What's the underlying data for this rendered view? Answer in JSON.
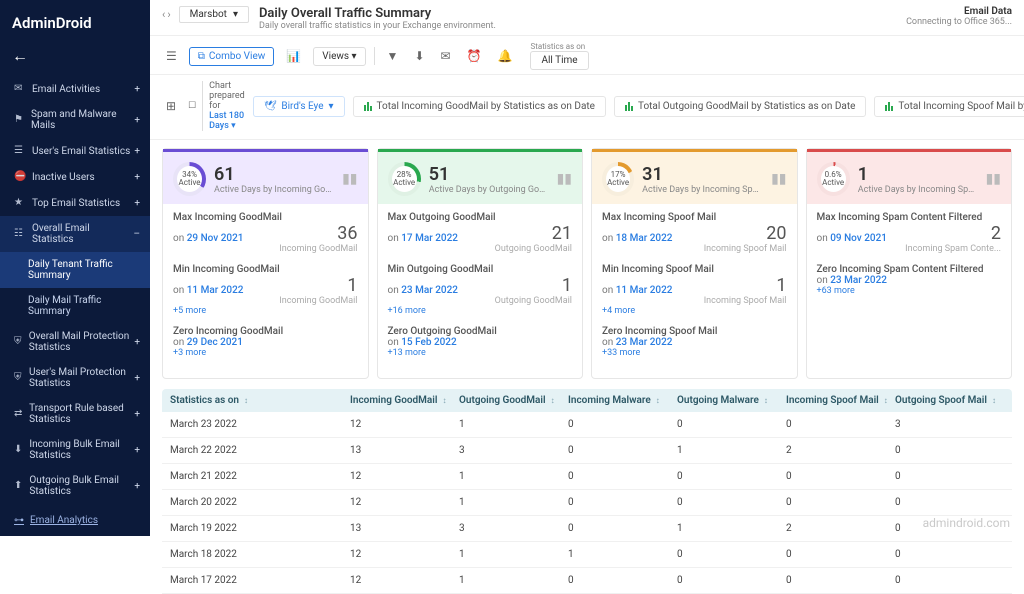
{
  "brand": "AdminDroid",
  "marsbot": "Marsbot",
  "title": "Daily Overall Traffic Summary",
  "subtitle": "Daily overall traffic statistics in your Exchange environment.",
  "top_right": {
    "title": "Email Data",
    "status": "Connecting to Office 365..."
  },
  "sidebar": {
    "items": [
      {
        "label": "Email Activities"
      },
      {
        "label": "Spam and Malware Mails"
      },
      {
        "label": "User's Email Statistics"
      },
      {
        "label": "Inactive Users"
      },
      {
        "label": "Top Email Statistics"
      },
      {
        "label": "Overall Email Statistics"
      },
      {
        "label": "Overall Mail Protection Statistics"
      },
      {
        "label": "User's Mail Protection Statistics"
      },
      {
        "label": "Transport Rule based Statistics"
      },
      {
        "label": "Incoming Bulk Email Statistics"
      },
      {
        "label": "Outgoing Bulk Email Statistics"
      }
    ],
    "subitems": [
      {
        "label": "Daily Tenant Traffic Summary",
        "active": true
      },
      {
        "label": "Daily Mail Traffic Summary"
      }
    ],
    "footer": "Email Analytics"
  },
  "toolbar": {
    "combo": "Combo View",
    "views": "Views",
    "stats_label": "Statistics as on",
    "stats_value": "All Time",
    "chart_prepared_label": "Chart prepared for",
    "chart_prepared_value": "Last 180 Days"
  },
  "tabs": [
    {
      "label": "Bird's Eye",
      "active": true
    },
    {
      "label": "Total Incoming GoodMail by Statistics as on Date"
    },
    {
      "label": "Total Outgoing GoodMail by Statistics as on Date"
    },
    {
      "label": "Total Incoming Spoof Mail by Statistics as on Date"
    }
  ],
  "cards": [
    {
      "pct": "34%",
      "active": "Active",
      "value": "61",
      "label": "Active Days by Incoming Goo...",
      "stats": [
        {
          "title": "Max Incoming GoodMail",
          "date": "29 Nov 2021",
          "value": "36",
          "unit": "Incoming GoodMail",
          "more": ""
        },
        {
          "title": "Min Incoming GoodMail",
          "date": "11 Mar 2022",
          "value": "1",
          "unit": "Incoming GoodMail",
          "more": "+5 more"
        },
        {
          "title": "Zero Incoming GoodMail",
          "date": "29 Dec 2021",
          "value": "",
          "unit": "",
          "more": "+3 more"
        }
      ]
    },
    {
      "pct": "28%",
      "active": "Active",
      "value": "51",
      "label": "Active Days by Outgoing Goo...",
      "stats": [
        {
          "title": "Max Outgoing GoodMail",
          "date": "17 Mar 2022",
          "value": "21",
          "unit": "Outgoing GoodMail",
          "more": ""
        },
        {
          "title": "Min Outgoing GoodMail",
          "date": "23 Mar 2022",
          "value": "1",
          "unit": "Outgoing GoodMail",
          "more": "+16 more"
        },
        {
          "title": "Zero Outgoing GoodMail",
          "date": "15 Feb 2022",
          "value": "",
          "unit": "",
          "more": "+13 more"
        }
      ]
    },
    {
      "pct": "17%",
      "active": "Active",
      "value": "31",
      "label": "Active Days by Incoming Spoo...",
      "stats": [
        {
          "title": "Max Incoming Spoof Mail",
          "date": "18 Mar 2022",
          "value": "20",
          "unit": "Incoming Spoof Mail",
          "more": ""
        },
        {
          "title": "Min Incoming Spoof Mail",
          "date": "11 Mar 2022",
          "value": "1",
          "unit": "Incoming Spoof Mail",
          "more": "+4 more"
        },
        {
          "title": "Zero Incoming Spoof Mail",
          "date": "23 Mar 2022",
          "value": "",
          "unit": "",
          "more": "+33 more"
        }
      ]
    },
    {
      "pct": "0.6%",
      "active": "Active",
      "value": "1",
      "label": "Active Days by Incoming Spa...",
      "stats": [
        {
          "title": "Max Incoming Spam Content Filtered",
          "date": "09 Nov 2021",
          "value": "2",
          "unit": "Incoming Spam Conte...",
          "more": ""
        },
        {
          "title": "Zero Incoming Spam Content Filtered",
          "date": "23 Mar 2022",
          "value": "",
          "unit": "",
          "more": "+63 more"
        }
      ]
    }
  ],
  "table": {
    "headers": [
      "Statistics as on",
      "Incoming GoodMail",
      "Outgoing GoodMail",
      "Incoming Malware",
      "Outgoing Malware",
      "Incoming Spoof Mail",
      "Outgoing Spoof Mail"
    ],
    "rows": [
      [
        "March 23 2022",
        "12",
        "1",
        "0",
        "0",
        "0",
        "3"
      ],
      [
        "March 22 2022",
        "13",
        "3",
        "0",
        "1",
        "2",
        "0"
      ],
      [
        "March 21 2022",
        "12",
        "1",
        "0",
        "0",
        "0",
        "0"
      ],
      [
        "March 20 2022",
        "12",
        "1",
        "0",
        "0",
        "0",
        "0"
      ],
      [
        "March 19 2022",
        "13",
        "3",
        "0",
        "1",
        "2",
        "0"
      ],
      [
        "March 18 2022",
        "12",
        "1",
        "1",
        "0",
        "0",
        "0"
      ],
      [
        "March 17 2022",
        "12",
        "1",
        "0",
        "0",
        "0",
        "0"
      ]
    ]
  },
  "watermark": "admindroid.com"
}
